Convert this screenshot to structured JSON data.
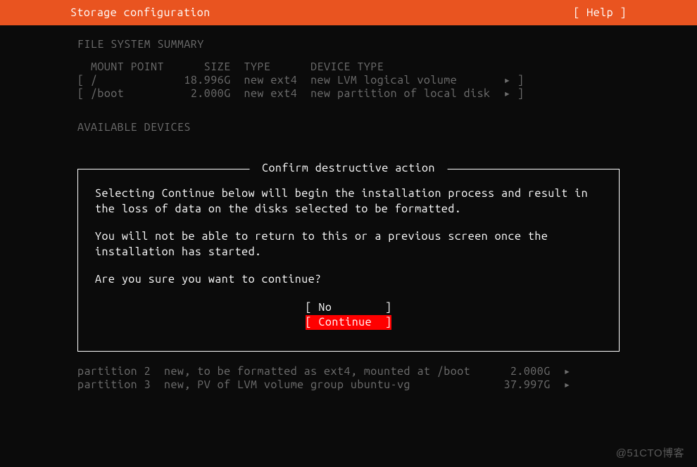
{
  "header": {
    "title": "Storage configuration",
    "help": "[ Help ]"
  },
  "fs_summary": {
    "heading": "FILE SYSTEM SUMMARY",
    "headers": {
      "mount": "MOUNT POINT",
      "size": "SIZE",
      "type": "TYPE",
      "device": "DEVICE TYPE"
    },
    "rows": [
      {
        "mount": "/",
        "size": "18.996G",
        "type": "new ext4",
        "device": "new LVM logical volume"
      },
      {
        "mount": "/boot",
        "size": "2.000G",
        "type": "new ext4",
        "device": "new partition of local disk"
      }
    ]
  },
  "available_devices_heading": "AVAILABLE DEVICES",
  "dialog": {
    "title": " Confirm destructive action ",
    "para1": "Selecting Continue below will begin the installation process and result in the loss of data on the disks selected to be formatted.",
    "para2": "You will not be able to return to this or a previous screen once the installation has started.",
    "para3": "Are you sure you want to continue?",
    "no_label": "[ No        ]",
    "continue_label": "[ Continue  ]"
  },
  "partitions": [
    {
      "name": "partition 2",
      "desc": "new, to be formatted as ext4, mounted at /boot",
      "size": "2.000G"
    },
    {
      "name": "partition 3",
      "desc": "new, PV of LVM volume group ubuntu-vg",
      "size": "37.997G"
    }
  ],
  "arrow": "▸",
  "watermark": "@51CTO博客"
}
